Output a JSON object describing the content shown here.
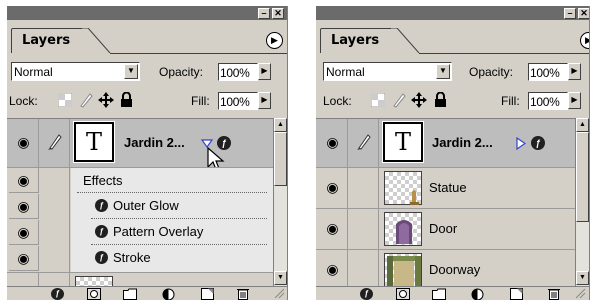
{
  "panels": [
    {
      "tab_label": "Layers",
      "blend_mode": "Normal",
      "opacity_label": "Opacity:",
      "opacity_value": "100%",
      "lock_label": "Lock:",
      "fill_label": "Fill:",
      "fill_value": "100%",
      "text_layer": {
        "thumb_glyph": "T",
        "name": "Jardin 2...",
        "expand_state": "expanded"
      },
      "effects_header": "Effects",
      "effects": [
        "Outer Glow",
        "Pattern Overlay",
        "Stroke"
      ],
      "fx_glyph": "ƒ"
    },
    {
      "tab_label": "Layers",
      "blend_mode": "Normal",
      "opacity_label": "Opacity:",
      "opacity_value": "100%",
      "lock_label": "Lock:",
      "fill_label": "Fill:",
      "fill_value": "100%",
      "text_layer": {
        "thumb_glyph": "T",
        "name": "Jardin 2...",
        "expand_state": "collapsed"
      },
      "layers": [
        "Statue",
        "Door",
        "Doorway"
      ],
      "fx_glyph": "ƒ"
    }
  ],
  "icons": {
    "eye": "eye-icon",
    "brush": "brush-icon",
    "lock_transparency": "lock-transparency-icon",
    "lock_paint": "lock-paint-icon",
    "lock_move": "lock-move-icon",
    "lock_all": "lock-all-icon",
    "layer_style": "layer-style-icon",
    "mask": "add-mask-icon",
    "new_set": "new-set-icon",
    "adjustment": "adjustment-layer-icon",
    "new_layer": "new-layer-icon",
    "trash": "trash-icon"
  },
  "colors": {
    "panel_bg": "#d4d0c8",
    "title_bar": "#6b6b6b",
    "highlight_row": "#bdbdbd",
    "effects_bg": "#e8e8e8"
  }
}
